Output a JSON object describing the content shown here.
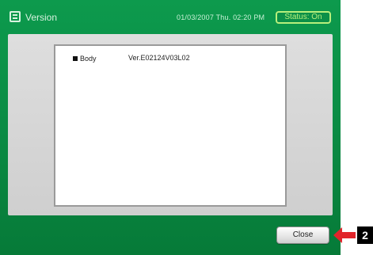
{
  "window": {
    "title": "Version",
    "datetime": "01/03/2007 Thu. 02:20 PM",
    "status": "Status: On"
  },
  "version_info": {
    "label": "Body",
    "value": "Ver.E02124V03L02"
  },
  "buttons": {
    "close": "Close"
  },
  "callout": {
    "number": "2"
  },
  "colors": {
    "frame_green": "#0a8a43",
    "status_accent": "#b8f07c",
    "callout_arrow": "#e1252b"
  },
  "icons": {
    "title": "window-icon",
    "callout": "arrow-left-icon"
  }
}
